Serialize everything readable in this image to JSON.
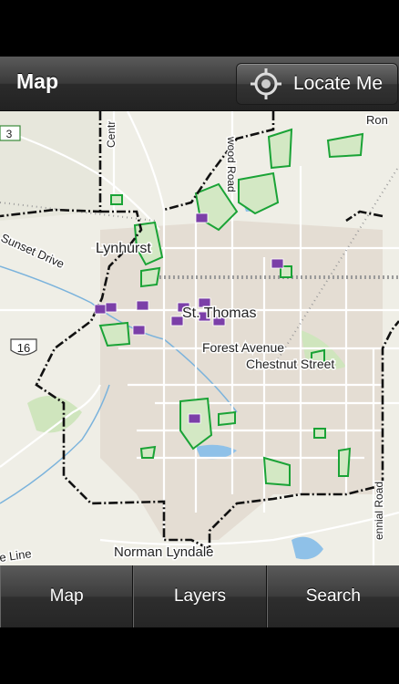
{
  "header": {
    "title": "Map",
    "locate_button_label": "Locate Me"
  },
  "map": {
    "place_labels": {
      "lynhurst": "Lynhurst",
      "st_thomas": "St. Thomas",
      "sunset_drive": "Sunset Drive",
      "forest_avenue": "Forest Avenue",
      "chestnut_street": "Chestnut Street",
      "norman_lyndale": "Norman Lyndale",
      "highway_16": "16",
      "highway_3": "3",
      "wood_road": "wood Road",
      "centennial_road": "ennial Road",
      "ron": "Ron",
      "line": "e Line",
      "centr": "Centr"
    }
  },
  "tabs": [
    {
      "label": "Map"
    },
    {
      "label": "Layers"
    },
    {
      "label": "Search"
    }
  ],
  "colors": {
    "nav_bar": "#2f2f2f",
    "map_background": "#efeee6",
    "park_fill": "#c9e3b5",
    "park_outline": "#1aa336",
    "boundary": "#111111",
    "marker": "#7b3fa8",
    "water": "#8fc1e8"
  }
}
